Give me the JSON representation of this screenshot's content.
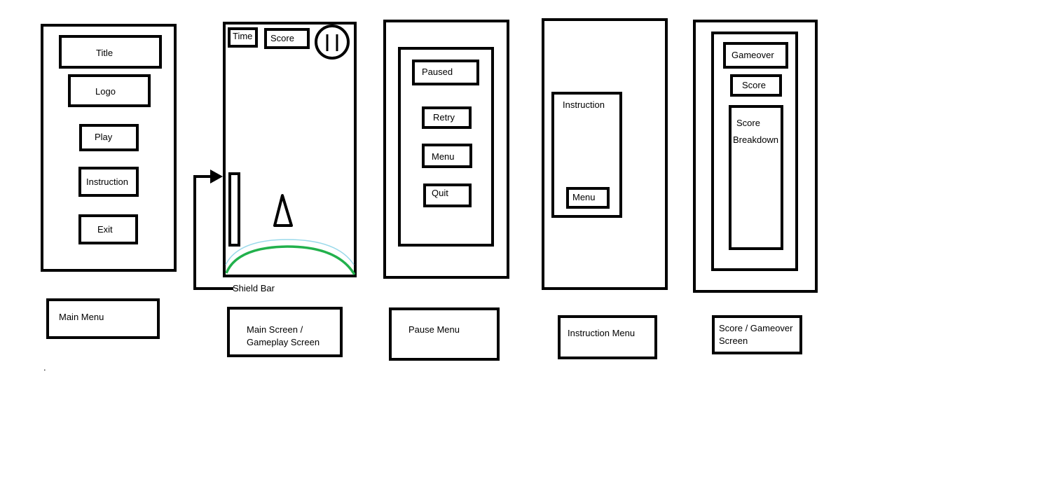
{
  "main_menu": {
    "title": "Title",
    "logo": "Logo",
    "play": "Play",
    "instruction": "Instruction",
    "exit": "Exit",
    "caption": "Main Menu"
  },
  "gameplay": {
    "time": "Time",
    "score": "Score",
    "shield_bar": "Shield Bar",
    "caption": "Main Screen /\nGameplay Screen",
    "colors": {
      "shield_arc": "#22b14c",
      "shield_arc_outer": "#99d9ea"
    }
  },
  "pause_menu": {
    "paused": "Paused",
    "retry": "Retry",
    "menu": "Menu",
    "quit": "Quit",
    "caption": "Pause Menu"
  },
  "instruction_menu": {
    "instruction": "Instruction",
    "menu": "Menu",
    "caption": "Instruction Menu"
  },
  "gameover": {
    "gameover": "Gameover",
    "score": "Score",
    "breakdown": "Score\nBreakdown",
    "caption": "Score / Gameover\nScreen"
  },
  "misc": {
    "dot": "."
  }
}
